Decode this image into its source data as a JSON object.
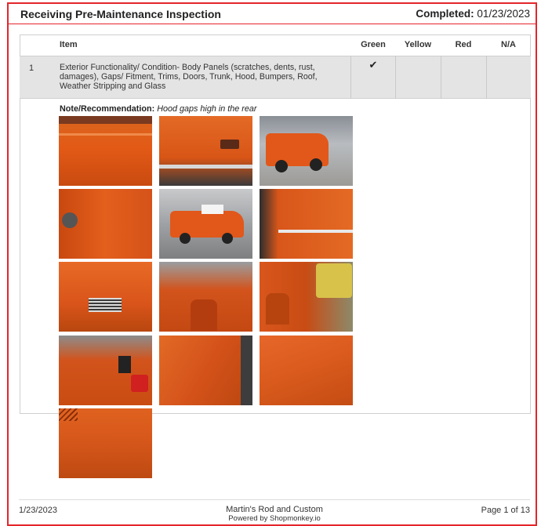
{
  "header": {
    "title": "Receiving Pre-Maintenance Inspection",
    "completed_label": "Completed:",
    "completed_date": "01/23/2023"
  },
  "table": {
    "columns": [
      "Item",
      "Green",
      "Yellow",
      "Red",
      "N/A"
    ],
    "rows": [
      {
        "number": "1",
        "item": "Exterior Functionality/ Condition- Body Panels (scratches, dents, rust, damages), Gaps/ Fitment, Trims, Doors, Trunk, Hood, Bumpers, Roof, Weather Stripping and Glass",
        "status_mark": "✔",
        "status": "Green",
        "note_label": "Note/Recommendation:",
        "note": "Hood gaps high in the rear"
      }
    ]
  },
  "photos": {
    "accent_color": "#e0541a"
  },
  "footer": {
    "date": "1/23/2023",
    "shop": "Martin's Rod and Custom",
    "powered_by": "Powered by Shopmonkey.io",
    "page": "Page 1 of 13"
  }
}
